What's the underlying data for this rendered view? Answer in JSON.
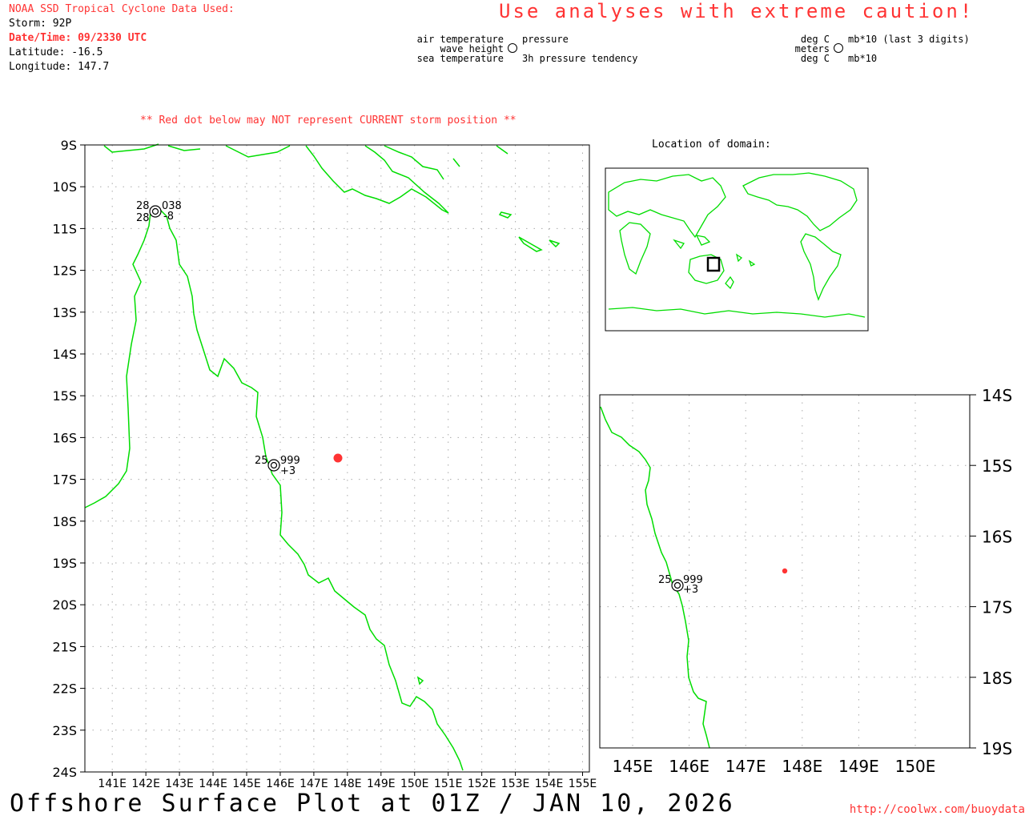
{
  "header": {
    "source_line": "NOAA SSD Tropical Cyclone Data Used:",
    "storm": "Storm: 92P",
    "datetime": "Date/Time: 09/2330 UTC",
    "latitude": "Latitude: -16.5",
    "longitude": "Longitude: 147.7",
    "caution": "Use analyses with extreme caution!"
  },
  "legend_left": {
    "air_temperature": "air temperature",
    "wave_height": "wave height",
    "sea_temperature": "sea temperature",
    "pressure": "pressure",
    "pressure_tendency": "3h pressure tendency"
  },
  "legend_right": {
    "deg_c_top": "deg C",
    "meters": "meters",
    "deg_c_bottom": "deg C",
    "mb_top": "mb*10 (last 3 digits)",
    "mb_bottom": "mb*10"
  },
  "warning": "** Red dot below may NOT represent CURRENT storm position **",
  "domain_label": "Location of domain:",
  "main_map": {
    "lat_labels": [
      "9S",
      "10S",
      "11S",
      "12S",
      "13S",
      "14S",
      "15S",
      "16S",
      "17S",
      "18S",
      "19S",
      "20S",
      "21S",
      "22S",
      "23S",
      "24S"
    ],
    "lon_labels": [
      "141E",
      "142E",
      "143E",
      "144E",
      "145E",
      "146E",
      "147E",
      "148E",
      "149E",
      "150E",
      "151E",
      "152E",
      "153E",
      "154E",
      "155E"
    ],
    "stations": [
      {
        "air": "28",
        "pressure": "038",
        "sea": "28",
        "tendency": "-8"
      },
      {
        "air": "25",
        "pressure": "999",
        "sea": "",
        "tendency": "+3"
      }
    ]
  },
  "inset_map": {
    "lat_labels": [
      "14S",
      "15S",
      "16S",
      "17S",
      "18S",
      "19S"
    ],
    "lon_labels": [
      "145E",
      "146E",
      "147E",
      "148E",
      "149E",
      "150E"
    ],
    "station": {
      "air": "25",
      "pressure": "999",
      "tendency": "+3"
    }
  },
  "footer": {
    "title": "Offshore Surface Plot at 01Z / JAN 10, 2026",
    "url": "http://coolwx.com/buoydata"
  },
  "colors": {
    "coast": "#00dd00",
    "alert": "#ff3333",
    "grid": "#aaaaaa",
    "storm_dot": "#ff3333"
  }
}
